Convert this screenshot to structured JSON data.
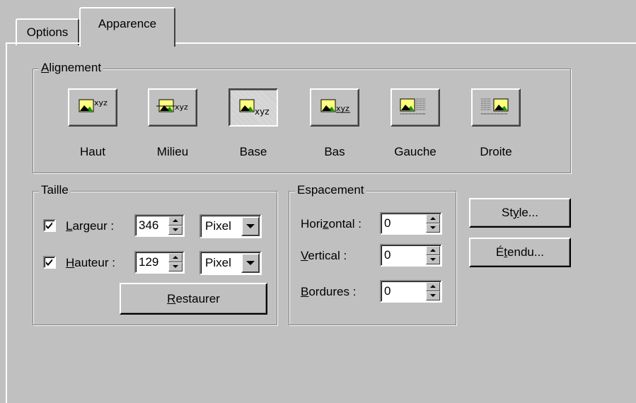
{
  "tabs": [
    {
      "label": "Options",
      "active": false
    },
    {
      "label": "Apparence",
      "active": true
    }
  ],
  "alignment": {
    "title_prefix": "",
    "title_accel": "A",
    "title_rest": "lignement",
    "selected": "Base",
    "options": [
      {
        "label": "Haut",
        "icon": "align-top-icon"
      },
      {
        "label": "Milieu",
        "icon": "align-middle-icon"
      },
      {
        "label": "Base",
        "icon": "align-baseline-icon"
      },
      {
        "label": "Bas",
        "icon": "align-bottom-icon"
      },
      {
        "label": "Gauche",
        "icon": "align-left-icon"
      },
      {
        "label": "Droite",
        "icon": "align-right-icon"
      }
    ],
    "icon_text": "xyz"
  },
  "size": {
    "title": "Taille",
    "width": {
      "checked": true,
      "label_accel": "L",
      "label_rest": "argeur :",
      "value": "346",
      "unit": "Pixel"
    },
    "height": {
      "checked": true,
      "label_accel": "H",
      "label_rest": "auteur :",
      "value": "129",
      "unit": "Pixel"
    },
    "reset": {
      "accel": "R",
      "rest": "estaurer"
    }
  },
  "spacing": {
    "title": "Espacement",
    "horizontal": {
      "pre": "Hori",
      "accel": "z",
      "post": "ontal :",
      "value": "0"
    },
    "vertical": {
      "pre": "",
      "accel": "V",
      "post": "ertical :",
      "value": "0"
    },
    "borders": {
      "pre": "",
      "accel": "B",
      "post": "ordures :",
      "value": "0"
    }
  },
  "buttons": {
    "style": {
      "pre": "St",
      "accel": "y",
      "post": "le..."
    },
    "extended": {
      "pre": "É",
      "accel": "t",
      "post": "endu..."
    }
  },
  "colors": {
    "face": "#c0c0c0",
    "image_fill": "#ffff80",
    "image_accent": "#00a000"
  }
}
